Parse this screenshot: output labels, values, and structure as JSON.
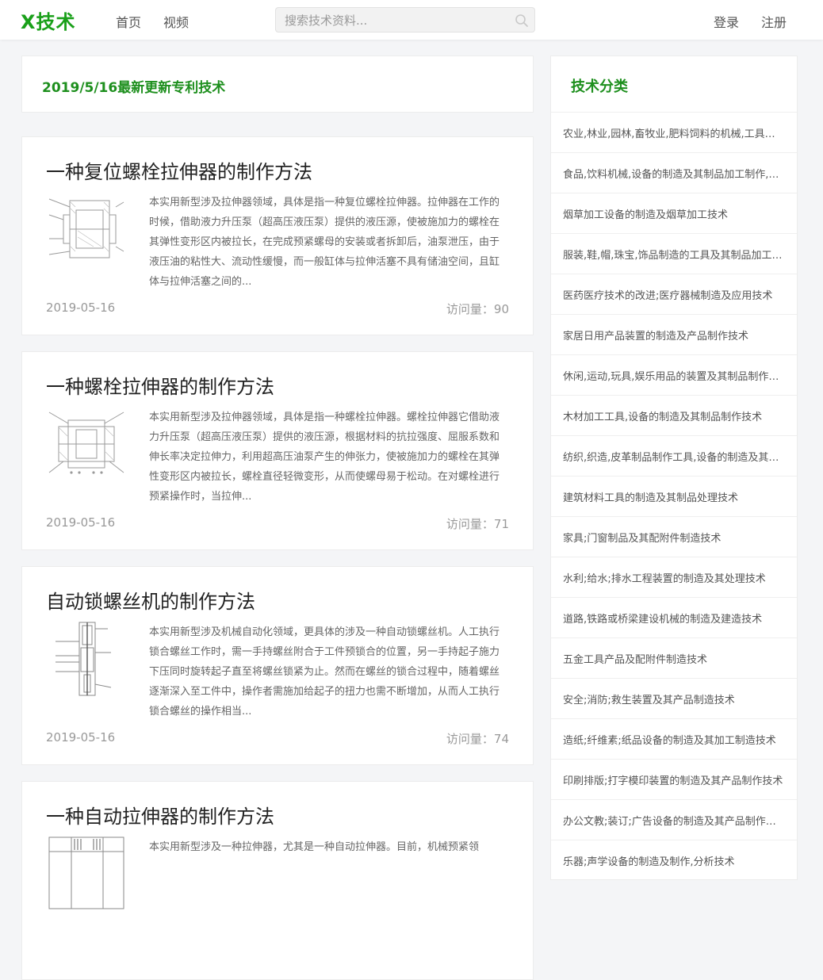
{
  "header": {
    "logo_text": "X技术",
    "nav": [
      {
        "label": "首页"
      },
      {
        "label": "视频"
      }
    ],
    "search": {
      "placeholder": "搜索技术资料..."
    },
    "login_label": "登录",
    "register_label": "注册"
  },
  "main": {
    "date_heading": "2019/5/16最新更新专利技术",
    "posts": [
      {
        "title": "一种复位螺栓拉伸器的制作方法",
        "excerpt": "本实用新型涉及拉伸器领域，具体是指一种复位螺栓拉伸器。拉伸器在工作的时候，借助液力升压泵（超高压液压泵）提供的液压源，使被施加力的螺栓在其弹性变形区内被拉长，在完成预紧螺母的安装或者拆卸后，油泵泄压，由于液压油的粘性大、流动性缓慢，而一般缸体与拉伸活塞不具有储油空间，且缸体与拉伸活塞之间的...",
        "date": "2019-05-16",
        "views": "访问量：90"
      },
      {
        "title": "一种螺栓拉伸器的制作方法",
        "excerpt": "本实用新型涉及拉伸器领域，具体是指一种螺栓拉伸器。螺栓拉伸器它借助液力升压泵（超高压液压泵）提供的液压源，根据材料的抗拉强度、屈服系数和伸长率决定拉伸力，利用超高压油泵产生的伸张力，使被施加力的螺栓在其弹性变形区内被拉长，螺栓直径轻微变形，从而使螺母易于松动。在对螺栓进行预紧操作时，当拉伸...",
        "date": "2019-05-16",
        "views": "访问量：71"
      },
      {
        "title": "自动锁螺丝机的制作方法",
        "excerpt": "本实用新型涉及机械自动化领域，更具体的涉及一种自动锁螺丝机。人工执行锁合螺丝工作时，需一手持螺丝附合于工件预锁合的位置，另一手持起子施力下压同时旋转起子直至将螺丝锁紧为止。然而在螺丝的锁合过程中，随着螺丝逐渐深入至工件中，操作者需施加给起子的扭力也需不断增加，从而人工执行锁合螺丝的操作相当...",
        "date": "2019-05-16",
        "views": "访问量：74"
      },
      {
        "title": "一种自动拉伸器的制作方法",
        "excerpt": "本实用新型涉及一种拉伸器，尤其是一种自动拉伸器。目前，机械预紧领",
        "date": "",
        "views": ""
      }
    ]
  },
  "sidebar": {
    "title": "技术分类",
    "categories": [
      "农业,林业,园林,畜牧业,肥料饲料的机械,工具制造及其应用技术",
      "食品,饮料机械,设备的制造及其制品加工制作,储藏技术",
      "烟草加工设备的制造及烟草加工技术",
      "服装,鞋,帽,珠宝,饰品制造的工具及其制品加工技术",
      "医药医疗技术的改进;医疗器械制造及应用技术",
      "家居日用产品装置的制造及产品制作技术",
      "休闲,运动,玩具,娱乐用品的装置及其制品制作技术",
      "木材加工工具,设备的制造及其制品制作技术",
      "纺织,织造,皮革制品制作工具,设备的制造及其制品加工技术",
      "建筑材料工具的制造及其制品处理技术",
      "家具;门窗制品及其配附件制造技术",
      "水利;给水;排水工程装置的制造及其处理技术",
      "道路,铁路或桥梁建设机械的制造及建造技术",
      "五金工具产品及配附件制造技术",
      "安全;消防;救生装置及其产品制造技术",
      "造纸;纤维素;纸品设备的制造及其加工制造技术",
      "印刷排版;打字模印装置的制造及其产品制作技术",
      "办公文教;装订;广告设备的制造及其产品制作技术",
      "乐器;声学设备的制造及制作,分析技术"
    ]
  },
  "colors": {
    "brand_green": "#1aa01a",
    "heading_green": "#1d8f1d",
    "page_background": "#f4f5f7"
  }
}
